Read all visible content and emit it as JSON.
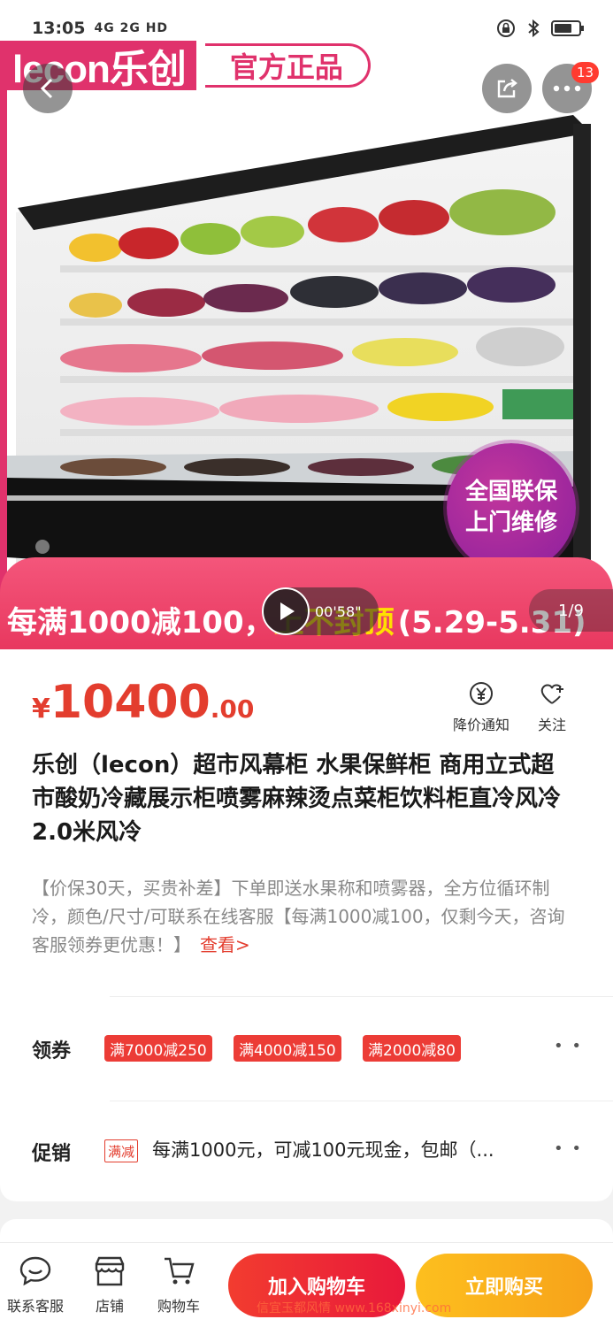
{
  "status_bar": {
    "time": "13:05",
    "network": "4G 2G HD",
    "battery_level": 0.72
  },
  "hero": {
    "brand_logo": "lecon乐创",
    "brand_tag": "官方正品",
    "notification_count": "13",
    "warranty_line1": "全国联保",
    "warranty_line2": "上门维修",
    "promo_prefix": "每满1000减100，",
    "promo_highlight": "上不封顶",
    "promo_dates": "(5.29-5.31)",
    "video_time": "00'58\"",
    "page_indicator": "1/9"
  },
  "product": {
    "price_currency": "¥",
    "price_integer": "10400",
    "price_decimal": ".00",
    "price_alert_label": "降价通知",
    "follow_label": "关注",
    "title": "乐创（lecon）超市风幕柜 水果保鲜柜 商用立式超市酸奶冷藏展示柜喷雾麻辣烫点菜柜饮料柜直冷风冷 2.0米风冷",
    "description": "【价保30天，买贵补差】下单即送水果称和喷雾器，全方位循环制冷，颜色/尺寸/可联系在线客服【每满1000减100，仅剩今天，咨询客服领券更优惠！】",
    "see_more": "查看>"
  },
  "perks": {
    "coupon_label": "领券",
    "coupons": [
      "满7000减250",
      "满4000减150",
      "满2000减80"
    ],
    "promo_label": "促销",
    "promo_tag": "满减",
    "promo_desc": "每满1000元，可减100元现金，包邮（..."
  },
  "bottom_bar": {
    "service_label": "联系客服",
    "store_label": "店铺",
    "cart_label": "购物车",
    "add_to_cart": "加入购物车",
    "buy_now": "立即购买",
    "watermark": "信宜玉都风情 www.168xinyi.com"
  },
  "colors": {
    "brand_pink": "#e0326c",
    "price_red": "#e33d2e",
    "cart_red": "#f23c2f",
    "buy_orange": "#fdbf1e"
  }
}
